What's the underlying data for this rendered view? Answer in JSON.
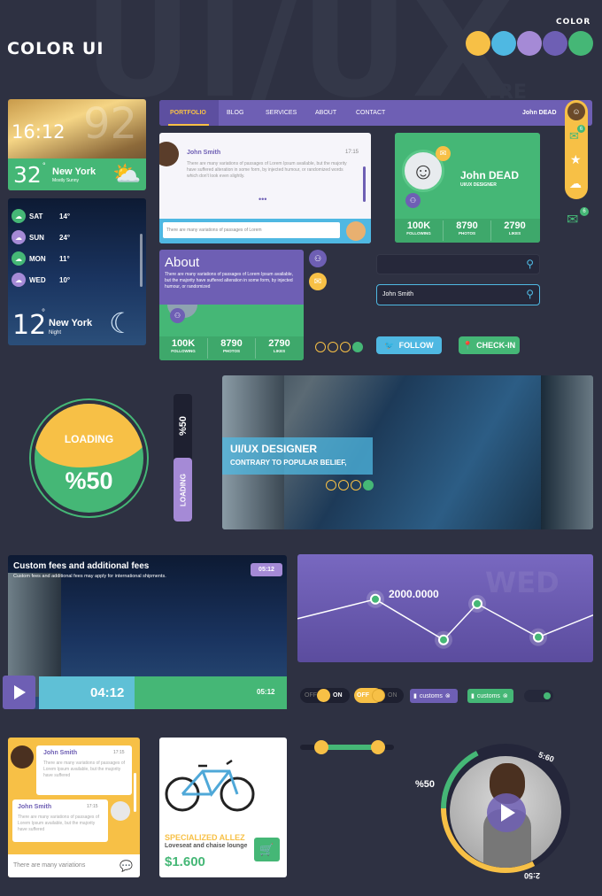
{
  "header": {
    "title": "COLOR UI",
    "color_label": "COLOR",
    "bg_text": "UI/UX",
    "bg_text_small": "FRE"
  },
  "palette": [
    "#f7c046",
    "#4fb8e2",
    "#a58ad6",
    "#6e5fb4",
    "#45b776"
  ],
  "weather": {
    "time": "16:12",
    "temp": "32",
    "city": "New York",
    "condition": "Mostly Sunny",
    "bg_num": "92",
    "days": [
      {
        "day": "SAT",
        "temp": "14°"
      },
      {
        "day": "SUN",
        "temp": "24°"
      },
      {
        "day": "MON",
        "temp": "11°"
      },
      {
        "day": "WED",
        "temp": "10°"
      }
    ],
    "night_temp": "12",
    "night_city": "New York",
    "night_condition": "Night"
  },
  "nav": {
    "items": [
      "PORTFOLIO",
      "BLOG",
      "SERVICES",
      "ABOUT",
      "CONTACT"
    ],
    "user": "John DEAD"
  },
  "chat1": {
    "name": "John Smith",
    "time": "17:15",
    "body": "There are many variations of passages of Lorem Ipsum available, but the majority have suffered alteration in some form, by injected humour, or randomized words which don't look even slightly.",
    "more": "•••",
    "input": "There are many variations of passages of Lorem"
  },
  "profile": {
    "name": "John DEAD",
    "role": "UI/UX DESIGNER",
    "stats": [
      {
        "v": "100K",
        "l": "FOLLOWING"
      },
      {
        "v": "8790",
        "l": "PHOTOS"
      },
      {
        "v": "2790",
        "l": "LIKES"
      }
    ]
  },
  "side_badges": [
    "6",
    "6"
  ],
  "about": {
    "title": "About",
    "body": "There are many variations of passages of Lorem Ipsum available, but the majority have suffered alteration in some form, by injected humour, or randomized",
    "stats": [
      {
        "v": "100K",
        "l": "FOLLOWING"
      },
      {
        "v": "8790",
        "l": "PHOTOS"
      },
      {
        "v": "2790",
        "l": "LIKES"
      }
    ]
  },
  "search": {
    "value2": "John Smith"
  },
  "buttons": {
    "follow": "FOLLOW",
    "checkin": "CHECK-IN"
  },
  "loading": {
    "label": "LOADING",
    "value": "%50",
    "progress": 0.5
  },
  "hero": {
    "title": "UI/UX DESIGNER",
    "subtitle": "CONTRARY TO POPULAR BELIEF,"
  },
  "video": {
    "title": "Custom fees and additional fees",
    "sub": "Custom fees and additional fees may apply for international shipments.",
    "badge": "05:12",
    "current": "04:12",
    "end": "05:12",
    "progress": 0.45
  },
  "linechart": {
    "label": "2000.0000",
    "bg": "WED",
    "values": [
      0.6,
      0.15,
      0.55,
      0.18
    ]
  },
  "toggles": {
    "off": "OFF",
    "on": "ON",
    "tag": "customs"
  },
  "chat2": {
    "m1_name": "John Smith",
    "m1_time": "17:15",
    "m1_body": "There are many variations of passages of Lorem Ipsum available, but the majority have suffered",
    "m2_name": "John Smith",
    "m2_time": "17:15",
    "m2_body": "There are many variations of passages of Lorem Ipsum available, but the majority have suffered",
    "input": "There are many variations"
  },
  "product": {
    "name": "SPECIALIZED ALLEZ",
    "desc": "Loveseat and chaise lounge",
    "price": "$1.600"
  },
  "player": {
    "percent": "%50",
    "t_top": "5:60",
    "t_bot": "2:50",
    "progress": 0.5
  }
}
